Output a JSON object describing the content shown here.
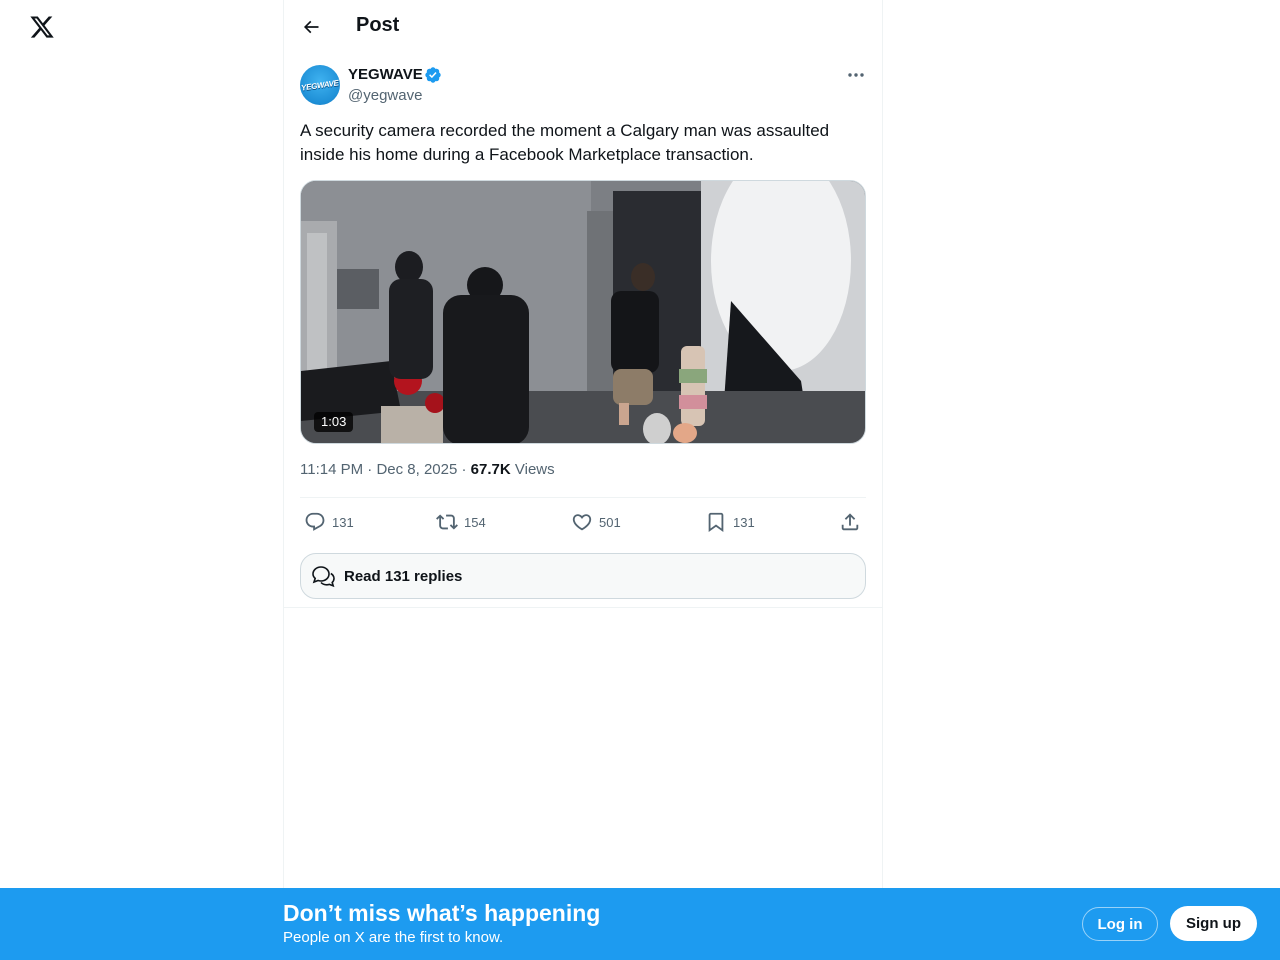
{
  "header": {
    "title": "Post"
  },
  "post": {
    "author": {
      "name": "YEGWAVE",
      "handle": "@yegwave",
      "avatar_text": "YEGWAVE",
      "verified": true
    },
    "text": "A security camera recorded the moment a Calgary man was assaulted inside his home during a Facebook Marketplace transaction.",
    "video": {
      "duration": "1:03"
    },
    "time": "11:14 PM",
    "date": "Dec 8, 2025",
    "separator": "·",
    "views_count": "67.7K",
    "views_label": "Views",
    "stats": {
      "replies": "131",
      "reposts": "154",
      "likes": "501",
      "bookmarks": "131"
    }
  },
  "read_replies": {
    "label": "Read 131 replies"
  },
  "banner": {
    "title": "Don’t miss what’s happening",
    "subtitle": "People on X are the first to know.",
    "login_label": "Log in",
    "signup_label": "Sign up"
  },
  "icons": {
    "logo": "x-logo-icon",
    "back": "arrow-left-icon",
    "verified": "verified-badge-icon",
    "more": "more-horizontal-icon",
    "reply": "reply-icon",
    "repost": "repost-icon",
    "like": "heart-icon",
    "bookmark": "bookmark-icon",
    "share": "share-icon",
    "replies": "speech-bubbles-icon"
  },
  "colors": {
    "accent": "#1d9bf0",
    "text": "#0f1419",
    "secondary": "#536471",
    "border": "#eff3f4"
  }
}
